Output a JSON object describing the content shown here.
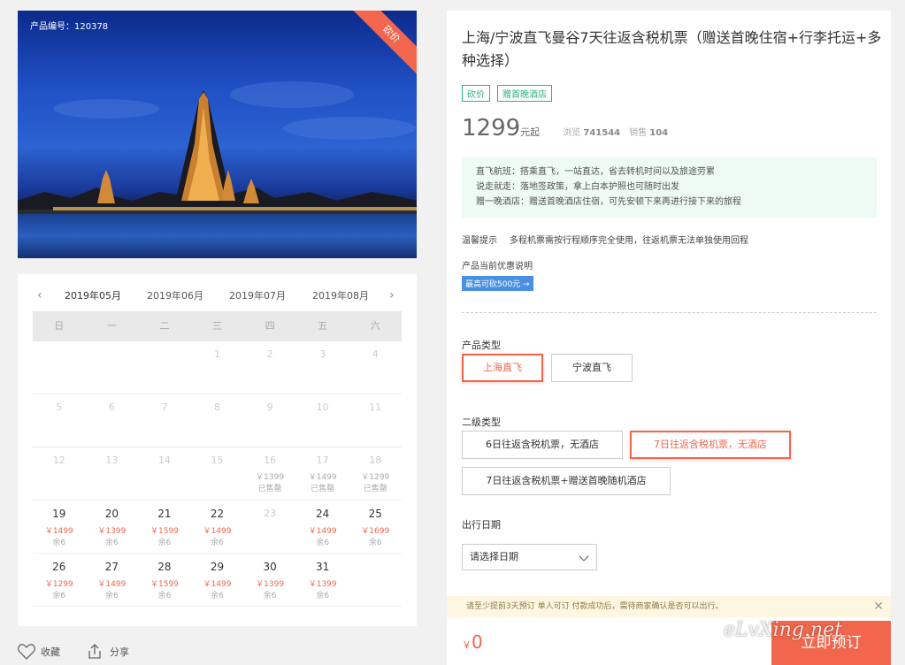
{
  "hero": {
    "product_code": "产品编号：120378",
    "ribbon": "砍价"
  },
  "calendar": {
    "prev": "‹",
    "next": "›",
    "months": [
      "2019年05月",
      "2019年06月",
      "2019年07月",
      "2019年08月"
    ],
    "weekdays": [
      "日",
      "一",
      "二",
      "三",
      "四",
      "五",
      "六"
    ],
    "weeks": [
      [
        {
          "d": ""
        },
        {
          "d": ""
        },
        {
          "d": ""
        },
        {
          "d": "1"
        },
        {
          "d": "2"
        },
        {
          "d": "3"
        },
        {
          "d": "4"
        }
      ],
      [
        {
          "d": "5"
        },
        {
          "d": "6"
        },
        {
          "d": "7"
        },
        {
          "d": "8"
        },
        {
          "d": "9"
        },
        {
          "d": "10"
        },
        {
          "d": "11"
        }
      ],
      [
        {
          "d": "12"
        },
        {
          "d": "13"
        },
        {
          "d": "14"
        },
        {
          "d": "15"
        },
        {
          "d": "16",
          "p": "￥1399",
          "s": "已售罄"
        },
        {
          "d": "17",
          "p": "￥1499",
          "s": "已售罄"
        },
        {
          "d": "18",
          "p": "￥1299",
          "s": "已售罄"
        }
      ],
      [
        {
          "d": "19",
          "p": "￥1499",
          "s": "余6",
          "a": true
        },
        {
          "d": "20",
          "p": "￥1399",
          "s": "余6",
          "a": true
        },
        {
          "d": "21",
          "p": "￥1599",
          "s": "余6",
          "a": true
        },
        {
          "d": "22",
          "p": "￥1499",
          "s": "余6",
          "a": true
        },
        {
          "d": "23"
        },
        {
          "d": "24",
          "p": "￥1499",
          "s": "余6",
          "a": true
        },
        {
          "d": "25",
          "p": "￥1699",
          "s": "余6",
          "a": true
        }
      ],
      [
        {
          "d": "26",
          "p": "￥1299",
          "s": "余6",
          "a": true
        },
        {
          "d": "27",
          "p": "￥1499",
          "s": "余6",
          "a": true
        },
        {
          "d": "28",
          "p": "￥1599",
          "s": "余6",
          "a": true
        },
        {
          "d": "29",
          "p": "￥1499",
          "s": "余6",
          "a": true
        },
        {
          "d": "30",
          "p": "￥1399",
          "s": "余6",
          "a": true
        },
        {
          "d": "31",
          "p": "￥1399",
          "s": "余6",
          "a": true
        },
        {
          "d": ""
        }
      ]
    ]
  },
  "actions": {
    "favorite": "收藏",
    "share": "分享"
  },
  "product": {
    "title": "上海/宁波直飞曼谷7天往返含税机票（赠送首晚住宿+行李托运+多种选择）",
    "tags": [
      "砍价",
      "赠首晚酒店"
    ],
    "price": "1299",
    "price_unit": "元起",
    "views_label": "浏览",
    "views": "741544",
    "sales_label": "销售",
    "sales": "104",
    "highlights": [
      "直飞航班：搭乘直飞，一站直达，省去转机时间以及旅途劳累",
      "说走就走：落地签政策，拿上白本护照也可随时出发",
      "赠一晚酒店：赠送首晚酒店住宿，可先安顿下来再进行接下来的旅程"
    ],
    "tip_label": "温馨提示",
    "tip_text": "多程机票需按行程顺序完全使用，往返机票无法单独使用回程",
    "promo_title": "产品当前优惠说明",
    "promo_badge": "最高可砍500元 →",
    "type_label": "产品类型",
    "types": [
      "上海直飞",
      "宁波直飞"
    ],
    "subtype_label": "二级类型",
    "subtypes": [
      "6日往返含税机票，无酒店",
      "7日往返含税机票，无酒店",
      "7日往返含税机票+赠送首晚随机酒店"
    ],
    "date_label": "出行日期",
    "date_placeholder": "请选择日期",
    "notice": "请至少提前3天预订  单人可订  付款成功后，需待商家确认是否可以出行。",
    "notice_close": "✕",
    "total_currency": "￥",
    "total": "0",
    "buy": "立即预订"
  },
  "watermark": "eLvXing.net"
}
